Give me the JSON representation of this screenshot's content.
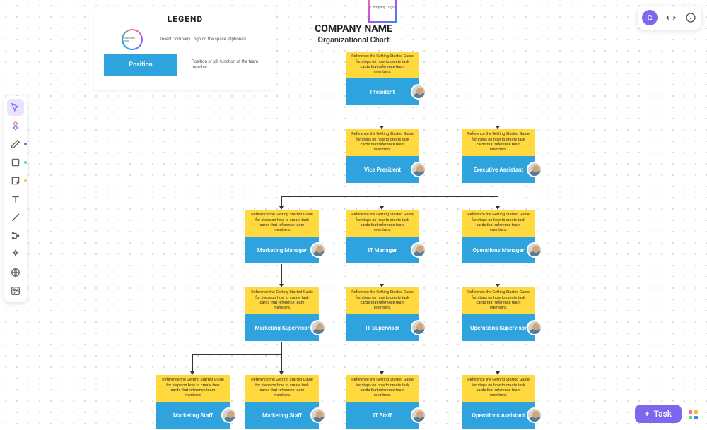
{
  "header": {
    "company": "COMPANY NAME",
    "subtitle": "Organizational Chart",
    "logo_text": "Company Logo"
  },
  "legend": {
    "title": "LEGEND",
    "logo_text": "Company Logo",
    "logo_desc": "Insert Company Logo on the space (Optional)",
    "position_label": "Position",
    "position_desc": "Position or job function of the team member"
  },
  "ref_text": "Reference the Getting Started Guide for steps on how to create task cards that reference team members.",
  "positions": {
    "president": "President",
    "vp": "Vice President",
    "ea": "Executive Assistant",
    "mm": "Marketing Manager",
    "itm": "IT Manager",
    "om": "Operations Manager",
    "ms": "Marketing Supervisor",
    "its": "IT Supervisor",
    "os": "Operations Supervisor",
    "mstaff1": "Marketing Staff",
    "mstaff2": "Marketing Staff",
    "itstaff": "IT Staff",
    "oa": "Operations Assistant"
  },
  "toolbar": {
    "cursor": "cursor",
    "diamond": "diamond",
    "pen": "pen",
    "square": "square",
    "note": "note",
    "text": "text",
    "line": "line",
    "connector": "connector",
    "sparkle": "sparkle",
    "globe": "globe",
    "image": "image"
  },
  "topbar": {
    "user": "C",
    "fit": "fit",
    "info": "info"
  },
  "task_button": "Task"
}
